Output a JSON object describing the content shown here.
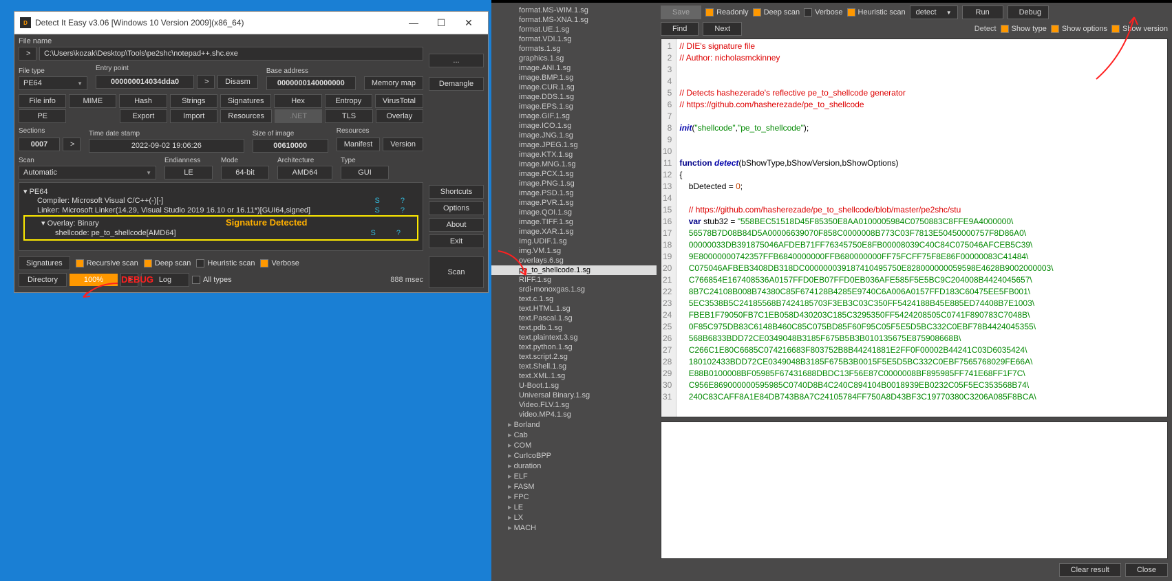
{
  "die": {
    "title": "Detect It Easy v3.06 [Windows 10 Version 2009](x86_64)",
    "icon_text": "D",
    "file_name_label": "File name",
    "file_path": "C:\\Users\\kozak\\Desktop\\Tools\\pe2shc\\notepad++.shc.exe",
    "browse": "...",
    "browse_left": ">",
    "fields": {
      "file_type_label": "File type",
      "file_type": "PE64",
      "entry_point_label": "Entry point",
      "entry_point": "000000014034dda0",
      "ep_more": ">",
      "disasm": "Disasm",
      "base_address_label": "Base address",
      "base_address": "0000000140000000",
      "memory_map": "Memory map",
      "demangle": "Demangle"
    },
    "btnrow1": [
      "File info",
      "MIME",
      "Hash",
      "Strings",
      "Signatures",
      "Hex",
      "Entropy",
      "VirusTotal"
    ],
    "btnrow2": [
      "PE",
      "",
      "Export",
      "Import",
      "Resources",
      ".NET",
      "TLS",
      "Overlay"
    ],
    "sections_label": "Sections",
    "sections": "0007",
    "sections_more": ">",
    "timestamp_label": "Time date stamp",
    "timestamp": "2022-09-02 19:06:26",
    "size_label": "Size of image",
    "size": "00610000",
    "resources_label": "Resources",
    "manifest": "Manifest",
    "version": "Version",
    "scan_label": "Scan",
    "scan_mode": "Automatic",
    "endian_label": "Endianness",
    "endian": "LE",
    "mode_label": "Mode",
    "mode": "64-bit",
    "arch_label": "Architecture",
    "arch": "AMD64",
    "type_label": "Type",
    "type": "GUI",
    "results": {
      "root": "PE64",
      "rows": [
        {
          "text": "Compiler: Microsoft Visual C/C++(-)[-]",
          "s": "S",
          "q": "?"
        },
        {
          "text": "Linker: Microsoft Linker(14.29, Visual Studio 2019 16.10 or 16.11*)[GUI64,signed]",
          "s": "S",
          "q": "?"
        },
        {
          "text": "Overlay: Binary",
          "s": "",
          "q": "",
          "boxed": true
        },
        {
          "text": "shellcode: pe_to_shellcode[AMD64]",
          "s": "S",
          "q": "?",
          "boxed_child": true
        }
      ]
    },
    "signature_detected": "Signature Detected",
    "debug_anno": "DEBUG",
    "signatures_btn": "Signatures",
    "recursive": "Recursive scan",
    "deep": "Deep scan",
    "heuristic": "Heuristic scan",
    "verbose": "Verbose",
    "directory_btn": "Directory",
    "progress": "100%",
    "progress_more": ">",
    "log_btn": "Log",
    "all_types": "All types",
    "elapsed": "888 msec",
    "side_btns": [
      "Shortcuts",
      "Options",
      "About",
      "Exit"
    ],
    "scan_btn": "Scan"
  },
  "editor": {
    "save": "Save",
    "readonly": "Readonly",
    "deep_scan": "Deep scan",
    "verbose": "Verbose",
    "heuristic": "Heuristic scan",
    "detect_sel": "detect",
    "run": "Run",
    "debug": "Debug",
    "find": "Find",
    "next": "Next",
    "detect_label": "Detect",
    "show_type": "Show type",
    "show_options": "Show options",
    "show_version": "Show version",
    "clear_result": "Clear result",
    "close": "Close",
    "files": [
      "format.MS-WIM.1.sg",
      "format.MS-XNA.1.sg",
      "format.UE.1.sg",
      "format.VDI.1.sg",
      "formats.1.sg",
      "graphics.1.sg",
      "image.ANI.1.sg",
      "image.BMP.1.sg",
      "image.CUR.1.sg",
      "image.DDS.1.sg",
      "image.EPS.1.sg",
      "image.GIF.1.sg",
      "image.ICO.1.sg",
      "image.JNG.1.sg",
      "image.JPEG.1.sg",
      "image.KTX.1.sg",
      "image.MNG.1.sg",
      "image.PCX.1.sg",
      "image.PNG.1.sg",
      "image.PSD.1.sg",
      "image.PVR.1.sg",
      "image.QOI.1.sg",
      "image.TIFF.1.sg",
      "image.XAR.1.sg",
      "Img.UDIF.1.sg",
      "img.VM.1.sg",
      "overlays.6.sg",
      "pe_to_shellcode.1.sg",
      "RIFF.1.sg",
      "srdi-monoxgas.1.sg",
      "text.c.1.sg",
      "text.HTML.1.sg",
      "text.Pascal.1.sg",
      "text.pdb.1.sg",
      "text.plaintext.3.sg",
      "text.python.1.sg",
      "text.script.2.sg",
      "text.Shell.1.sg",
      "text.XML.1.sg",
      "U-Boot.1.sg",
      "Universal Binary.1.sg",
      "Video.FLV.1.sg",
      "video.MP4.1.sg"
    ],
    "selected_file": "pe_to_shellcode.1.sg",
    "folders": [
      "Borland",
      "Cab",
      "COM",
      "CurIcoBPP",
      "duration",
      "ELF",
      "FASM",
      "FPC",
      "LE",
      "LX",
      "MACH"
    ],
    "code_lines": [
      {
        "n": 1,
        "t": "// DIE's signature file",
        "c": "comment"
      },
      {
        "n": 2,
        "t": "// Author: nicholasmckinney",
        "c": "comment"
      },
      {
        "n": 3,
        "t": "",
        "c": ""
      },
      {
        "n": 4,
        "t": "",
        "c": ""
      },
      {
        "n": 5,
        "t": "// Detects hashezerade's reflective pe_to_shellcode generator",
        "c": "comment"
      },
      {
        "n": 6,
        "t": "// https://github.com/hasherezade/pe_to_shellcode",
        "c": "comment"
      },
      {
        "n": 7,
        "t": "",
        "c": ""
      },
      {
        "n": 8,
        "raw": "<span class='cm-func'>init</span>(<span class='cm-string'>\"shellcode\"</span>,<span class='cm-string'>\"pe_to_shellcode\"</span>);"
      },
      {
        "n": 9,
        "t": "",
        "c": ""
      },
      {
        "n": 10,
        "t": "",
        "c": ""
      },
      {
        "n": 11,
        "raw": "<span class='cm-keyword'>function</span> <span class='cm-func'>detect</span>(bShowType,bShowVersion,bShowOptions)"
      },
      {
        "n": 12,
        "t": "{",
        "c": ""
      },
      {
        "n": 13,
        "raw": "    bDetected = <span class='cm-num'>0</span>;"
      },
      {
        "n": 14,
        "t": "",
        "c": ""
      },
      {
        "n": 15,
        "t": "    // https://github.com/hasherezade/pe_to_shellcode/blob/master/pe2shc/stu",
        "c": "comment"
      },
      {
        "n": 16,
        "raw": "    <span class='cm-keyword'>var</span> stub32 = <span class='cm-string'>\"558BEC51518D45F85350E8AA0100005984C0750883C8FFE9A4000000\\</span>"
      },
      {
        "n": 17,
        "raw": "<span class='cm-string'>    56578B7D08B84D5A00006639070F858C0000008B773C03F7813E50450000757F8D86A0\\</span>"
      },
      {
        "n": 18,
        "raw": "<span class='cm-string'>    00000033DB391875046AFDEB71FF76345750E8FB00008039C40C84C075046AFCEB5C39\\</span>"
      },
      {
        "n": 19,
        "raw": "<span class='cm-string'>    9E80000000742357FFB6840000000FFB680000000FF75FCFF75F8E86F00000083C41484\\</span>"
      },
      {
        "n": 20,
        "raw": "<span class='cm-string'>    C075046AFBEB3408DB318DC000000039187410495750E828000000059598E4628B9002000003\\</span>"
      },
      {
        "n": 21,
        "raw": "<span class='cm-string'>    C766854E167408536A0157FFD0EB07FFD0EB036AFE585F5E5BC9C204008B4424045657\\</span>"
      },
      {
        "n": 22,
        "raw": "<span class='cm-string'>    8B7C24108B008B74380C85F674128B4285E9740C6A006A0157FFD183C60475EE5FB001\\</span>"
      },
      {
        "n": 23,
        "raw": "<span class='cm-string'>    5EC3538B5C24185568B7424185703F3EB3C03C350FF5424188B45E885ED74408B7E1003\\</span>"
      },
      {
        "n": 24,
        "raw": "<span class='cm-string'>    FBEB1F79050FB7C1EB058D430203C185C3295350FF5424208505C0741F890783C7048B\\</span>"
      },
      {
        "n": 25,
        "raw": "<span class='cm-string'>    0F85C975DB83C6148B460C85C075BD85F60F95C05F5E5D5BC332C0EBF78B4424045355\\</span>"
      },
      {
        "n": 26,
        "raw": "<span class='cm-string'>    568B6833BDD72CE0349048B3185F675B5B3B010135675E875908668B\\</span>"
      },
      {
        "n": 27,
        "raw": "<span class='cm-string'>    C266C1E80C6685C074216683F803752B8B44241881E2FF0F00002B44241C03D6035424\\</span>"
      },
      {
        "n": 28,
        "raw": "<span class='cm-string'>    180102433BDD72CE0349048B3185F675B3B0015F5E5D5BC332C0EBF7565768029FE66A\\</span>"
      },
      {
        "n": 29,
        "raw": "<span class='cm-string'>    E88B0100008BF05985F67431688DBDC13F56E87C0000008BF895985FF741E68FF1F7C\\</span>"
      },
      {
        "n": 30,
        "raw": "<span class='cm-string'>    C956E869000000595985C0740D8B4C240C894104B0018939EB0232C05F5EC353568B74\\</span>"
      },
      {
        "n": 31,
        "raw": "<span class='cm-string'>    240C83CAFF8A1E84DB743B8A7C24105784FF750A8D43BF3C19770380C3206A085F8BCA\\</span>"
      }
    ]
  }
}
